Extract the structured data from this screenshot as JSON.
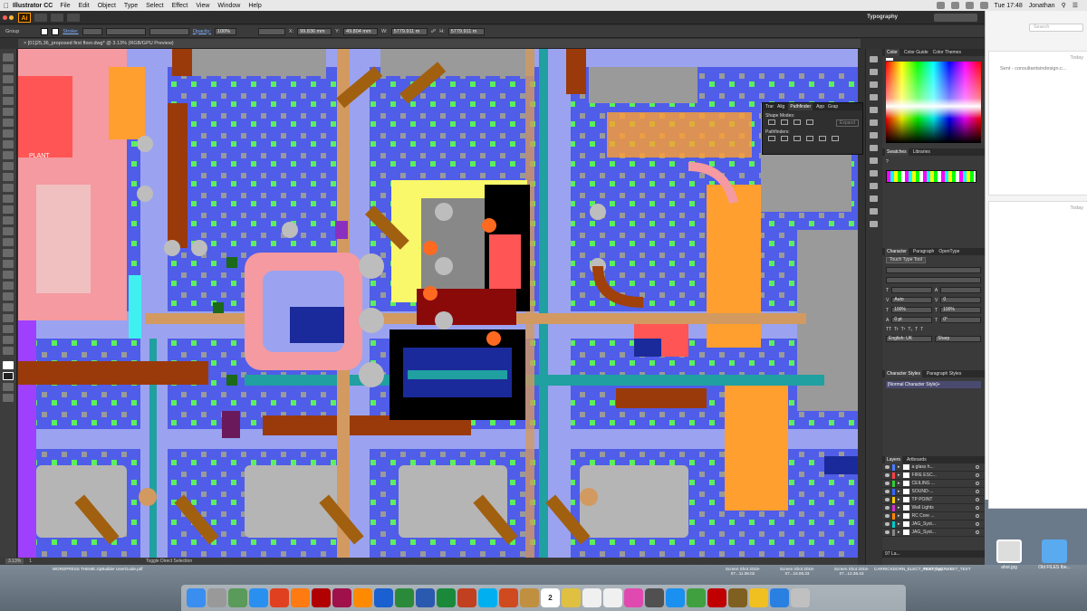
{
  "menubar": {
    "app_name": "Illustrator CC",
    "items": [
      "File",
      "Edit",
      "Object",
      "Type",
      "Select",
      "Effect",
      "View",
      "Window",
      "Help"
    ],
    "clock": "Tue 17:48",
    "user": "Jonathan"
  },
  "appbar": {
    "logo": "Ai",
    "workspace": "Typography"
  },
  "controlbar": {
    "selection": "Group",
    "stroke_label": "Stroke:",
    "opacity_label": "Opacity:",
    "opacity_value": "100%",
    "x_value": "99.836 mm",
    "y_value": "49.804 mm",
    "w_value": "5779.911 m",
    "h_value": "5779.911 m"
  },
  "document": {
    "tab_title": "[01]25,36_proposed first floor.dwg* @ 3.13% (RGB/GPU Preview)",
    "canvas_text": "PLANT"
  },
  "statusbar": {
    "zoom": "3.13%",
    "page": "1",
    "hint": "Toggle Direct Selection"
  },
  "pathfinder": {
    "tabs": [
      "Trar",
      "Alig",
      "Pathfinder",
      "App",
      "Grap"
    ],
    "shape_modes": "Shape Modes:",
    "pathfinders": "Pathfinders:",
    "expand": "Expand"
  },
  "panels": {
    "color_tabs": [
      "Color",
      "Color Guide",
      "Color Themes"
    ],
    "swatch_tabs": [
      "Swatches",
      "Libraries"
    ],
    "char_tabs": [
      "Character",
      "Paragraph",
      "OpenType"
    ],
    "touch_type": "Touch Type Tool",
    "font_size": "Auto",
    "leading": "0",
    "scale_h": "100%",
    "scale_v": "100%",
    "tracking": "0",
    "baseline": "0 pt",
    "rotation": "0°",
    "language": "English: UK",
    "antialias": "Sharp",
    "style_tabs": [
      "Character Styles",
      "Paragraph Styles"
    ],
    "style_item": "[Normal Character Style]+",
    "layer_tabs": [
      "Layers",
      "Artboards"
    ],
    "layers": [
      {
        "name": "a glass h...",
        "color": "#4a7bff"
      },
      {
        "name": "FIRE ESC...",
        "color": "#ff4040"
      },
      {
        "name": "CEILING ...",
        "color": "#33cc33"
      },
      {
        "name": "SOUND-...",
        "color": "#3366ff"
      },
      {
        "name": "TP POINT",
        "color": "#ffcc00"
      },
      {
        "name": "Wall Lights",
        "color": "#cc33cc"
      },
      {
        "name": "RC Core ...",
        "color": "#ff8800"
      },
      {
        "name": "JAG_Syst...",
        "color": "#00cccc"
      },
      {
        "name": "JAG_Syst...",
        "color": "#888888"
      }
    ],
    "layer_count": "97 La..."
  },
  "sidewin": {
    "search_placeholder": "Search",
    "today1": "Today",
    "sent": "Sent - consultantsindesign.c...",
    "today2": "Today"
  },
  "desktop": {
    "files": [
      "WORDPRESS THEME.zip",
      "Builder UserGuide.pdf",
      "Screen Shot 2016-07...11.08.02",
      "Screen Shot 2016-07...16.06.33",
      "Screen Shot 2016-07...12.36.43",
      "CARRICKDORN_ELECT_TEXT_bpp.ARF",
      "ProSTRUCT... LET_TEXT",
      "shot.jpg",
      "Old FILES ..."
    ],
    "icon_shot": "ahot.jpg",
    "icon_folder": "Old FILES Ibe..."
  },
  "dock": {
    "apps": [
      "Finder",
      "Launchpad",
      "Preview",
      "Safari",
      "Chrome",
      "Firefox",
      "Acrobat",
      "InDesign",
      "Illustrator",
      "Photoshop",
      "Dreamweaver",
      "Word",
      "Excel",
      "PowerPoint",
      "Skype",
      "Sublime",
      "Archive",
      "Calendar",
      "Notes",
      "Reminders",
      "TextEdit",
      "iTunes",
      "Dictionary",
      "App Store",
      "Transmit",
      "FileZilla",
      "Stickies",
      "Cyberduck",
      "Downloads",
      "Trash"
    ],
    "calendar_day": "2"
  }
}
